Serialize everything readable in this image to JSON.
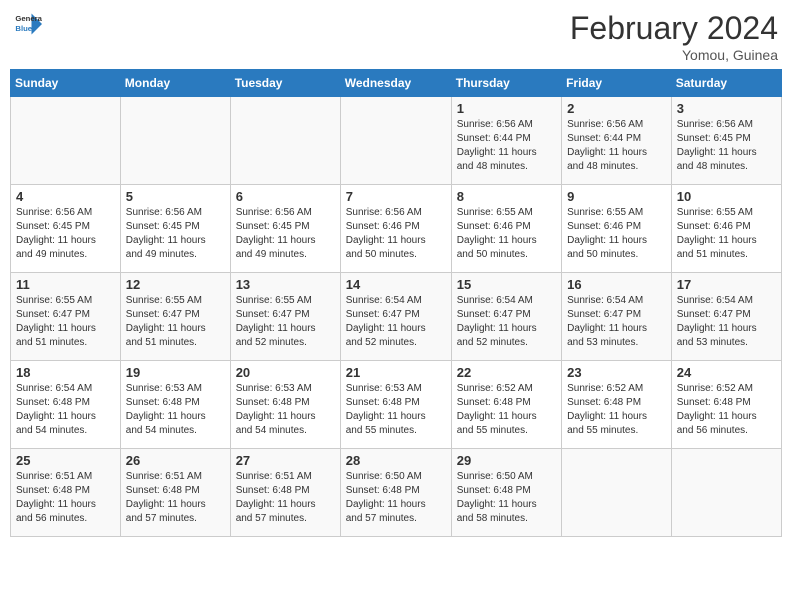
{
  "header": {
    "logo_line1": "General",
    "logo_line2": "Blue",
    "month_title": "February 2024",
    "subtitle": "Yomou, Guinea"
  },
  "days_of_week": [
    "Sunday",
    "Monday",
    "Tuesday",
    "Wednesday",
    "Thursday",
    "Friday",
    "Saturday"
  ],
  "weeks": [
    [
      {
        "day": "",
        "info": ""
      },
      {
        "day": "",
        "info": ""
      },
      {
        "day": "",
        "info": ""
      },
      {
        "day": "",
        "info": ""
      },
      {
        "day": "1",
        "info": "Sunrise: 6:56 AM\nSunset: 6:44 PM\nDaylight: 11 hours\nand 48 minutes."
      },
      {
        "day": "2",
        "info": "Sunrise: 6:56 AM\nSunset: 6:44 PM\nDaylight: 11 hours\nand 48 minutes."
      },
      {
        "day": "3",
        "info": "Sunrise: 6:56 AM\nSunset: 6:45 PM\nDaylight: 11 hours\nand 48 minutes."
      }
    ],
    [
      {
        "day": "4",
        "info": "Sunrise: 6:56 AM\nSunset: 6:45 PM\nDaylight: 11 hours\nand 49 minutes."
      },
      {
        "day": "5",
        "info": "Sunrise: 6:56 AM\nSunset: 6:45 PM\nDaylight: 11 hours\nand 49 minutes."
      },
      {
        "day": "6",
        "info": "Sunrise: 6:56 AM\nSunset: 6:45 PM\nDaylight: 11 hours\nand 49 minutes."
      },
      {
        "day": "7",
        "info": "Sunrise: 6:56 AM\nSunset: 6:46 PM\nDaylight: 11 hours\nand 50 minutes."
      },
      {
        "day": "8",
        "info": "Sunrise: 6:55 AM\nSunset: 6:46 PM\nDaylight: 11 hours\nand 50 minutes."
      },
      {
        "day": "9",
        "info": "Sunrise: 6:55 AM\nSunset: 6:46 PM\nDaylight: 11 hours\nand 50 minutes."
      },
      {
        "day": "10",
        "info": "Sunrise: 6:55 AM\nSunset: 6:46 PM\nDaylight: 11 hours\nand 51 minutes."
      }
    ],
    [
      {
        "day": "11",
        "info": "Sunrise: 6:55 AM\nSunset: 6:47 PM\nDaylight: 11 hours\nand 51 minutes."
      },
      {
        "day": "12",
        "info": "Sunrise: 6:55 AM\nSunset: 6:47 PM\nDaylight: 11 hours\nand 51 minutes."
      },
      {
        "day": "13",
        "info": "Sunrise: 6:55 AM\nSunset: 6:47 PM\nDaylight: 11 hours\nand 52 minutes."
      },
      {
        "day": "14",
        "info": "Sunrise: 6:54 AM\nSunset: 6:47 PM\nDaylight: 11 hours\nand 52 minutes."
      },
      {
        "day": "15",
        "info": "Sunrise: 6:54 AM\nSunset: 6:47 PM\nDaylight: 11 hours\nand 52 minutes."
      },
      {
        "day": "16",
        "info": "Sunrise: 6:54 AM\nSunset: 6:47 PM\nDaylight: 11 hours\nand 53 minutes."
      },
      {
        "day": "17",
        "info": "Sunrise: 6:54 AM\nSunset: 6:47 PM\nDaylight: 11 hours\nand 53 minutes."
      }
    ],
    [
      {
        "day": "18",
        "info": "Sunrise: 6:54 AM\nSunset: 6:48 PM\nDaylight: 11 hours\nand 54 minutes."
      },
      {
        "day": "19",
        "info": "Sunrise: 6:53 AM\nSunset: 6:48 PM\nDaylight: 11 hours\nand 54 minutes."
      },
      {
        "day": "20",
        "info": "Sunrise: 6:53 AM\nSunset: 6:48 PM\nDaylight: 11 hours\nand 54 minutes."
      },
      {
        "day": "21",
        "info": "Sunrise: 6:53 AM\nSunset: 6:48 PM\nDaylight: 11 hours\nand 55 minutes."
      },
      {
        "day": "22",
        "info": "Sunrise: 6:52 AM\nSunset: 6:48 PM\nDaylight: 11 hours\nand 55 minutes."
      },
      {
        "day": "23",
        "info": "Sunrise: 6:52 AM\nSunset: 6:48 PM\nDaylight: 11 hours\nand 55 minutes."
      },
      {
        "day": "24",
        "info": "Sunrise: 6:52 AM\nSunset: 6:48 PM\nDaylight: 11 hours\nand 56 minutes."
      }
    ],
    [
      {
        "day": "25",
        "info": "Sunrise: 6:51 AM\nSunset: 6:48 PM\nDaylight: 11 hours\nand 56 minutes."
      },
      {
        "day": "26",
        "info": "Sunrise: 6:51 AM\nSunset: 6:48 PM\nDaylight: 11 hours\nand 57 minutes."
      },
      {
        "day": "27",
        "info": "Sunrise: 6:51 AM\nSunset: 6:48 PM\nDaylight: 11 hours\nand 57 minutes."
      },
      {
        "day": "28",
        "info": "Sunrise: 6:50 AM\nSunset: 6:48 PM\nDaylight: 11 hours\nand 57 minutes."
      },
      {
        "day": "29",
        "info": "Sunrise: 6:50 AM\nSunset: 6:48 PM\nDaylight: 11 hours\nand 58 minutes."
      },
      {
        "day": "",
        "info": ""
      },
      {
        "day": "",
        "info": ""
      }
    ]
  ]
}
